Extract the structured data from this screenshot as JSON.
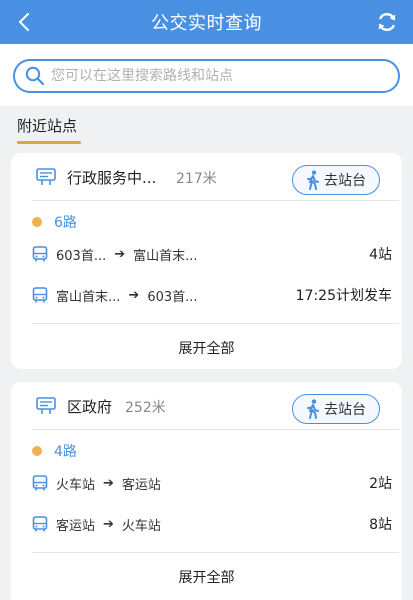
{
  "header": {
    "title": "公交实时查询"
  },
  "search": {
    "placeholder": "您可以在这里搜索路线和站点"
  },
  "tabs": {
    "nearby_label": "附近站点"
  },
  "colors": {
    "primary": "#4a90e2",
    "accent": "#e6a23c",
    "route_dot": "#f0b04e"
  },
  "stops": [
    {
      "name": "行政服务中...",
      "distance": "217米",
      "goto_label": "去站台",
      "route": "6路",
      "directions": [
        {
          "from": "603首...",
          "to": "富山首末...",
          "status": "4站"
        },
        {
          "from": "富山首末...",
          "to": "603首...",
          "status": "17:25计划发车"
        }
      ],
      "expand_label": "展开全部"
    },
    {
      "name": "区政府",
      "distance": "252米",
      "goto_label": "去站台",
      "route": "4路",
      "directions": [
        {
          "from": "火车站",
          "to": "客运站",
          "status": "2站"
        },
        {
          "from": "客运站",
          "to": "火车站",
          "status": "8站"
        }
      ],
      "expand_label": "展开全部"
    }
  ]
}
